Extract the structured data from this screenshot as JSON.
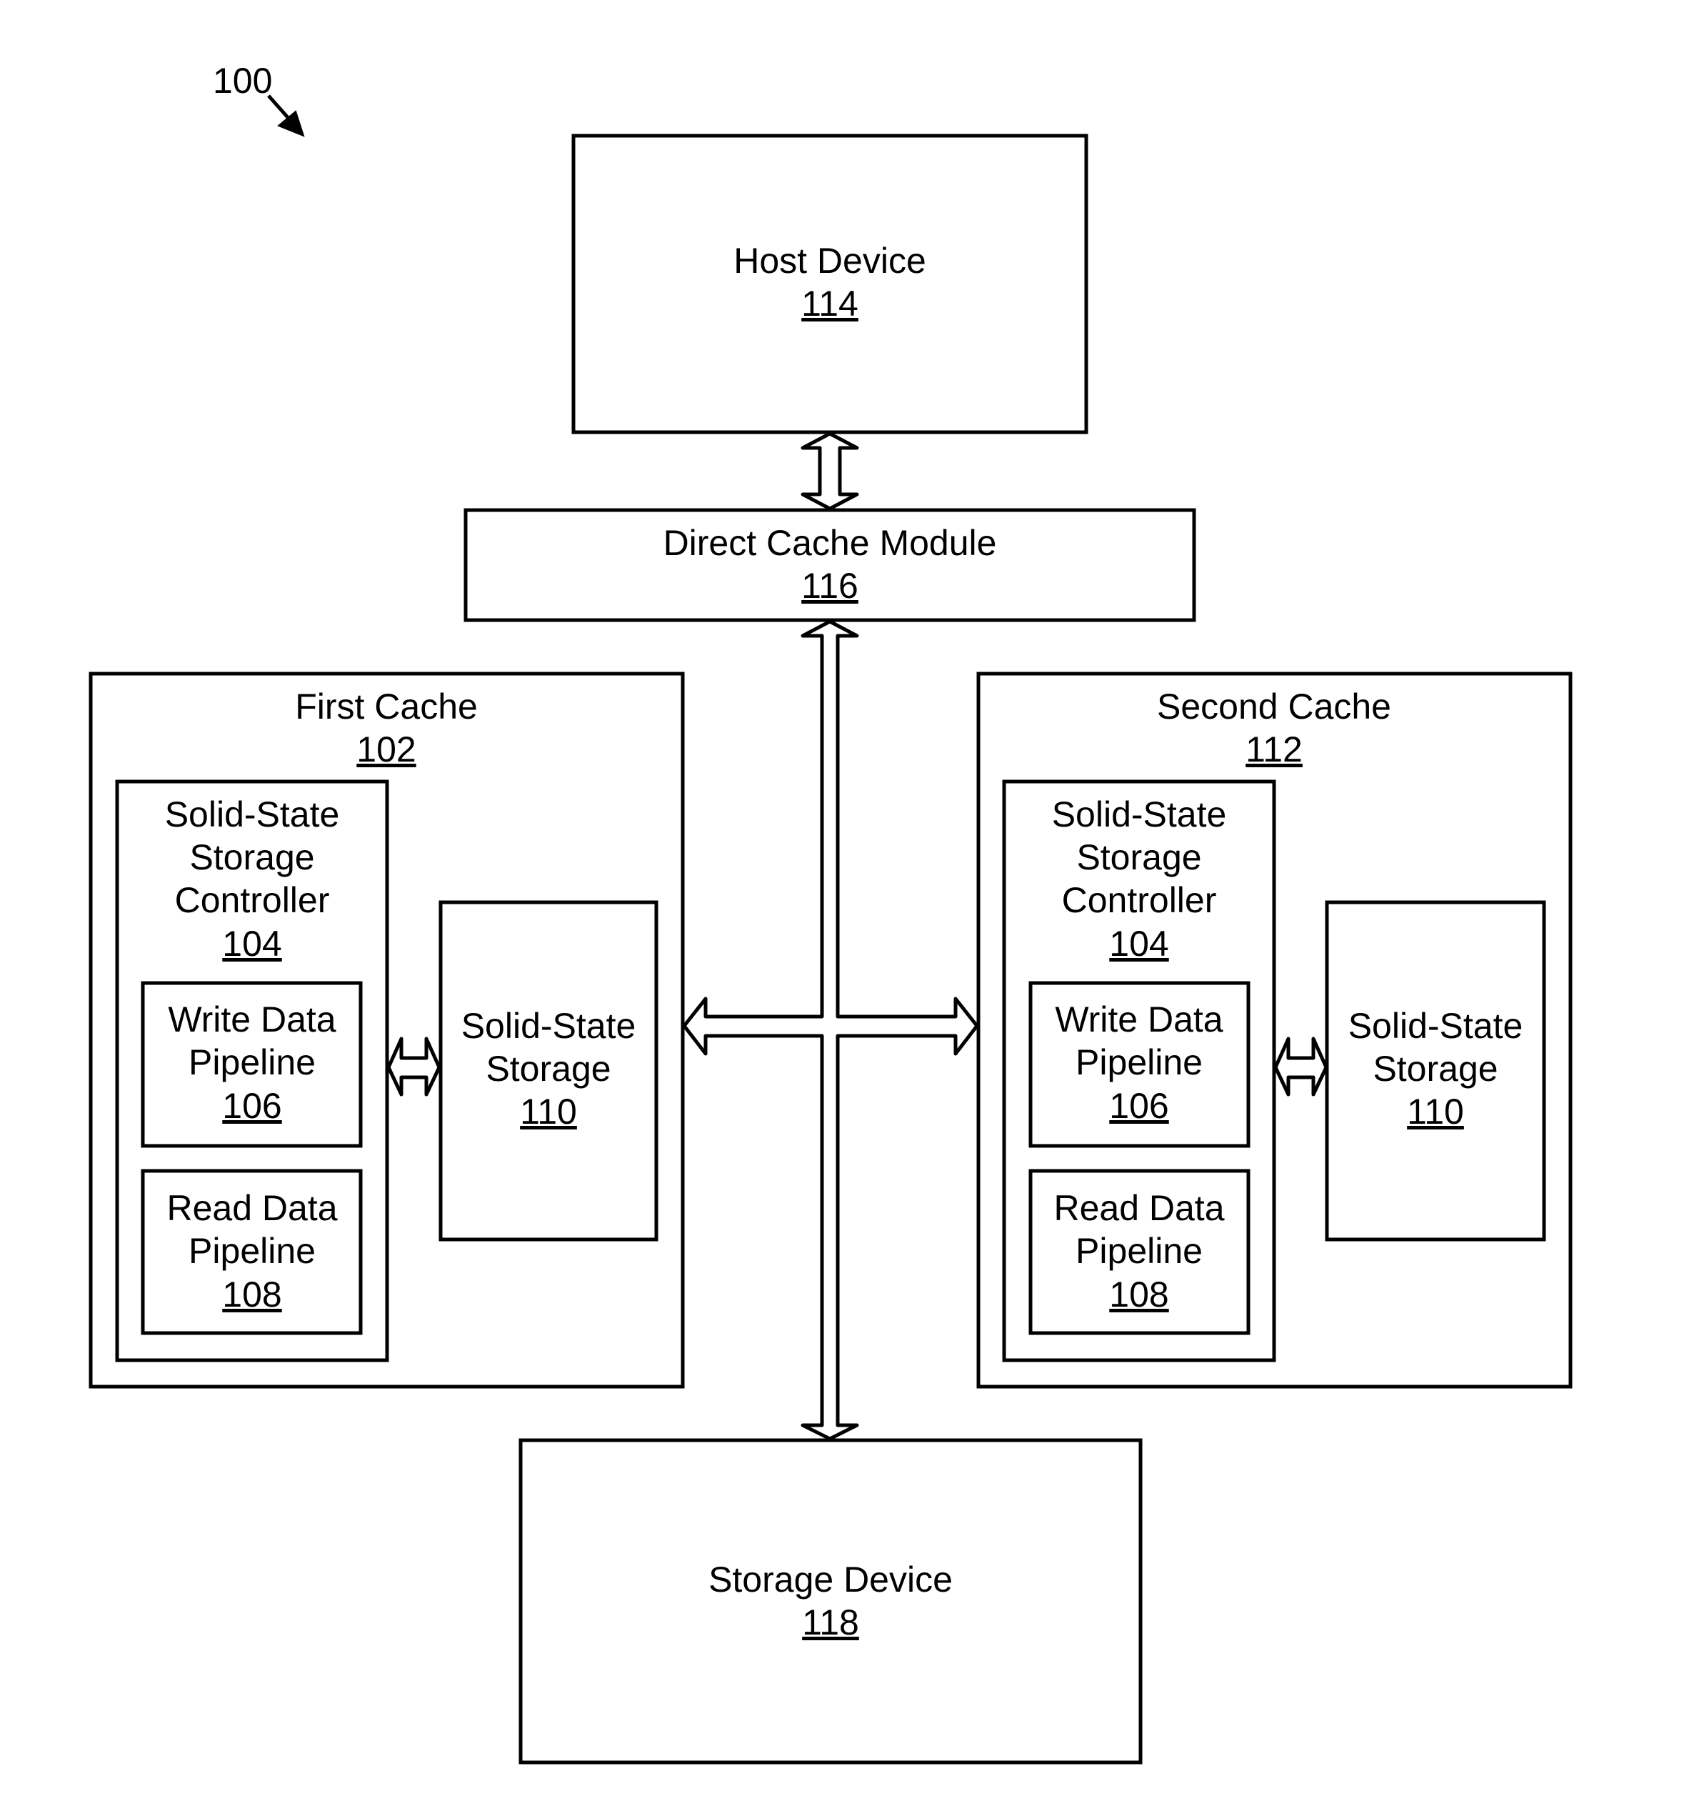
{
  "figure": {
    "reference": "100"
  },
  "host_device": {
    "label": "Host Device",
    "ref": "114"
  },
  "direct_cache_module": {
    "label": "Direct Cache Module",
    "ref": "116"
  },
  "first_cache": {
    "label": "First Cache",
    "ref": "102",
    "controller": {
      "lines": [
        "Solid-State",
        "Storage",
        "Controller"
      ],
      "ref": "104"
    },
    "write_pipeline": {
      "lines": [
        "Write Data",
        "Pipeline"
      ],
      "ref": "106"
    },
    "read_pipeline": {
      "lines": [
        "Read Data",
        "Pipeline"
      ],
      "ref": "108"
    },
    "storage": {
      "lines": [
        "Solid-State",
        "Storage"
      ],
      "ref": "110"
    }
  },
  "second_cache": {
    "label": "Second Cache",
    "ref": "112",
    "controller": {
      "lines": [
        "Solid-State",
        "Storage",
        "Controller"
      ],
      "ref": "104"
    },
    "write_pipeline": {
      "lines": [
        "Write Data",
        "Pipeline"
      ],
      "ref": "106"
    },
    "read_pipeline": {
      "lines": [
        "Read Data",
        "Pipeline"
      ],
      "ref": "108"
    },
    "storage": {
      "lines": [
        "Solid-State",
        "Storage"
      ],
      "ref": "110"
    }
  },
  "storage_device": {
    "label": "Storage Device",
    "ref": "118"
  },
  "connections": [
    {
      "from": "host_device",
      "to": "direct_cache_module",
      "type": "bidirectional"
    },
    {
      "from": "direct_cache_module",
      "to": "storage_device",
      "type": "bidirectional"
    },
    {
      "from": "direct_cache_module",
      "to": "first_cache",
      "type": "bidirectional"
    },
    {
      "from": "direct_cache_module",
      "to": "second_cache",
      "type": "bidirectional"
    },
    {
      "from": "first_cache.controller",
      "to": "first_cache.storage",
      "type": "bidirectional"
    },
    {
      "from": "second_cache.controller",
      "to": "second_cache.storage",
      "type": "bidirectional"
    }
  ]
}
